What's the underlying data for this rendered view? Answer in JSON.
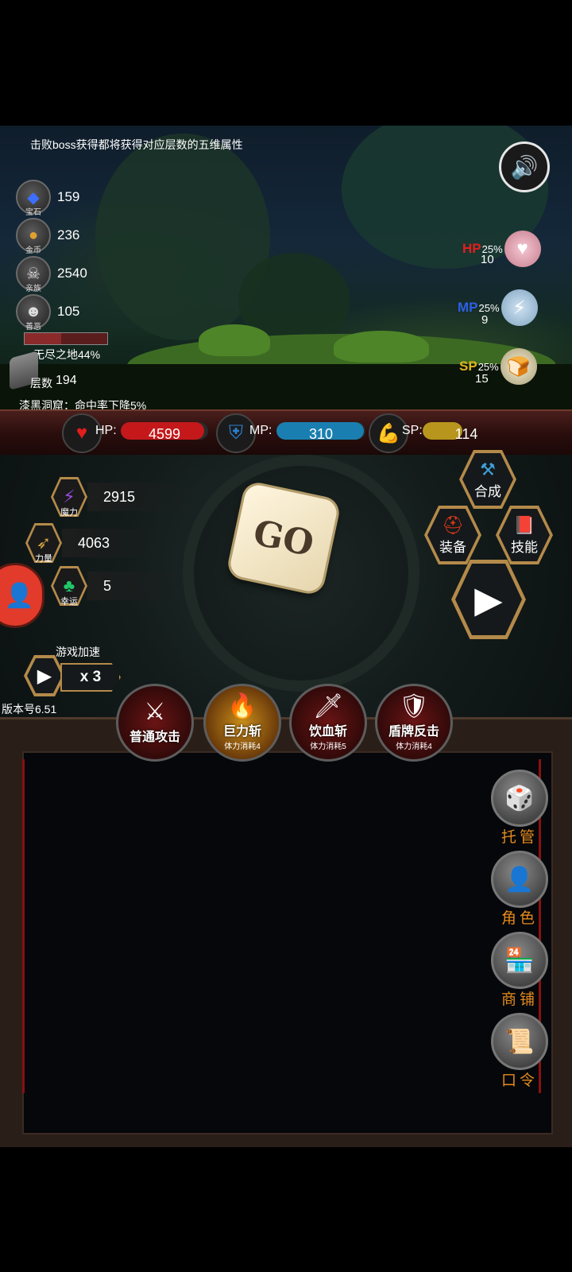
{
  "info_line": "击败boss获得都将获得对应层数的五维属性",
  "resources": [
    {
      "name": "宝石",
      "value": "159",
      "icon": "gem-icon"
    },
    {
      "name": "金币",
      "value": "236",
      "icon": "coin-icon"
    },
    {
      "name": "亲族",
      "value": "2540",
      "icon": "skull-icon"
    },
    {
      "name": "善恶",
      "value": "105",
      "icon": "mask-icon"
    }
  ],
  "land": {
    "name": "无尽之地44%",
    "floor_label": "层数",
    "floor": "194",
    "note": "漆黑洞窟：命中率下降5%"
  },
  "potions": [
    {
      "label": "HP",
      "pct": "25%",
      "count": "10",
      "color": "#e01e1e"
    },
    {
      "label": "MP",
      "pct": "25%",
      "count": "9",
      "color": "#2d5fe6"
    },
    {
      "label": "SP",
      "pct": "25%",
      "count": "15",
      "color": "#e0b21e"
    }
  ],
  "stats": {
    "hp": {
      "label": "HP:",
      "value": "4599",
      "fill": 0.95,
      "color": "#c4181b"
    },
    "mp": {
      "label": "MP:",
      "value": "310",
      "fill": 0.98,
      "color": "#1a7fb0"
    },
    "sp": {
      "label": "SP:",
      "value": "114",
      "fill": 0.45,
      "color": "#b8961e"
    }
  },
  "attributes": [
    {
      "name": "魔力",
      "value": "2915",
      "icon": "magic-icon"
    },
    {
      "name": "力量",
      "value": "4063",
      "icon": "bow-icon"
    },
    {
      "name": "幸运",
      "value": "5",
      "icon": "clover-icon"
    }
  ],
  "go_label": "GO",
  "actions": {
    "combine": "合成",
    "equip": "装备",
    "skill": "技能"
  },
  "speed": {
    "label": "游戏加速",
    "multiplier": "x 3"
  },
  "version": "版本号6.51",
  "skills": [
    {
      "name": "普通攻击",
      "cost": ""
    },
    {
      "name": "巨力斩",
      "cost": "体力消耗4"
    },
    {
      "name": "饮血斩",
      "cost": "体力消耗5"
    },
    {
      "name": "盾牌反击",
      "cost": "体力消耗4"
    }
  ],
  "side_menu": [
    "托管",
    "角色",
    "商铺",
    "口令"
  ]
}
